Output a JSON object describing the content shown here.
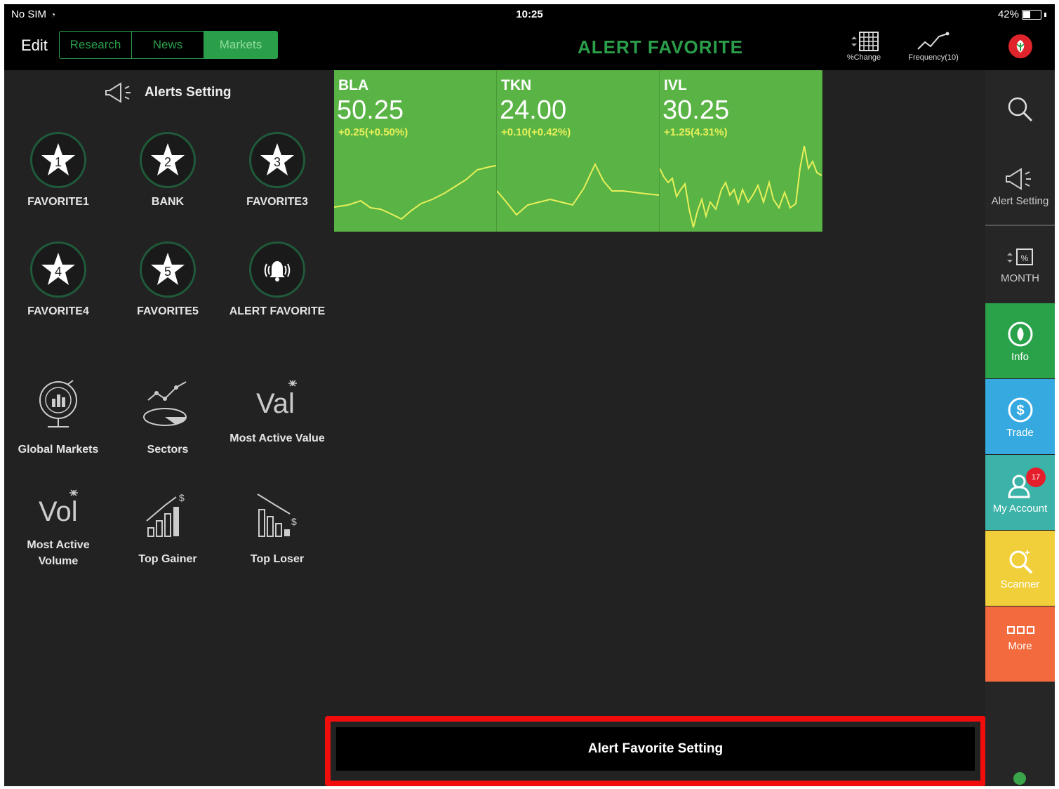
{
  "status_bar": {
    "carrier": "No SIM",
    "time": "10:25",
    "battery": "42%",
    "battery_level": 0.42
  },
  "nav": {
    "edit_label": "Edit",
    "tabs": [
      {
        "label": "Research",
        "active": false
      },
      {
        "label": "News",
        "active": false
      },
      {
        "label": "Markets",
        "active": true
      }
    ],
    "title": "ALERT FAVORITE",
    "tools": [
      {
        "label": "%Change",
        "icon": "grid-icon"
      },
      {
        "label": "Frequency(10)",
        "icon": "line-chart-icon"
      }
    ],
    "brand_icon": "brand-logo-icon"
  },
  "left_panel": {
    "alerts_setting_label": "Alerts Setting",
    "favorites": [
      {
        "num": "1",
        "label": "FAVORITE1"
      },
      {
        "num": "2",
        "label": "BANK"
      },
      {
        "num": "3",
        "label": "FAVORITE3"
      },
      {
        "num": "4",
        "label": "FAVORITE4"
      },
      {
        "num": "5",
        "label": "FAVORITE5"
      }
    ],
    "alert_favorite_label": "ALERT FAVORITE",
    "markets": [
      {
        "label": "Global Markets",
        "icon": "globe-chart-icon"
      },
      {
        "label": "Sectors",
        "icon": "sectors-icon"
      },
      {
        "label": "Most Active Value",
        "icon": "value-icon"
      },
      {
        "label": "Most Active Volume",
        "icon": "volume-icon"
      },
      {
        "label": "Top Gainer",
        "icon": "top-gainer-icon"
      },
      {
        "label": "Top Loser",
        "icon": "top-loser-icon"
      }
    ]
  },
  "tickers": [
    {
      "symbol": "BLA",
      "price": "50.25",
      "change": "+0.25(+0.50%)"
    },
    {
      "symbol": "TKN",
      "price": "24.00",
      "change": "+0.10(+0.42%)"
    },
    {
      "symbol": "IVL",
      "price": "30.25",
      "change": "+1.25(4.31%)"
    }
  ],
  "alert_favorite_setting_label": "Alert Favorite Setting",
  "right_sidebar": {
    "search_icon": "search-icon",
    "alert_setting_label": "Alert Setting",
    "period_label": "MONTH",
    "buttons": [
      {
        "label": "Info",
        "color": "#2aa24a",
        "icon": "info-icon"
      },
      {
        "label": "Trade",
        "color": "#36a9e1",
        "icon": "trade-icon"
      },
      {
        "label": "My Account",
        "color": "#3bb3a8",
        "icon": "account-icon",
        "badge": "17"
      },
      {
        "label": "Scanner",
        "color": "#f1cf3b",
        "icon": "scanner-icon"
      },
      {
        "label": "More",
        "color": "#f26a3d",
        "icon": "more-icon"
      }
    ]
  }
}
